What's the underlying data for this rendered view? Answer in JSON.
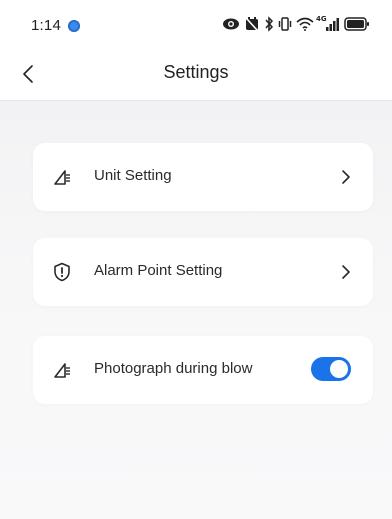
{
  "status_bar": {
    "time": "1:14",
    "network_label": "4G",
    "icons": [
      "app-notification-dot-icon",
      "eye-icon",
      "dnd-icon",
      "bluetooth-icon",
      "vibrate-icon",
      "wifi-icon",
      "signal-icon",
      "battery-icon"
    ]
  },
  "header": {
    "title": "Settings",
    "back_icon": "chevron-left-icon"
  },
  "settings": {
    "items": [
      {
        "label": "Unit Setting",
        "icon": "ruler-angle-icon",
        "control": "chevron-right-icon"
      },
      {
        "label": "Alarm Point Setting",
        "icon": "shield-alert-icon",
        "control": "chevron-right-icon"
      },
      {
        "label": "Photograph during blow",
        "icon": "ruler-angle-icon",
        "control": "toggle",
        "toggle_on": true
      }
    ]
  },
  "colors": {
    "accent": "#1a73e8",
    "background": "#f4f4f6",
    "card": "#ffffff",
    "text": "#2a2a2a"
  }
}
